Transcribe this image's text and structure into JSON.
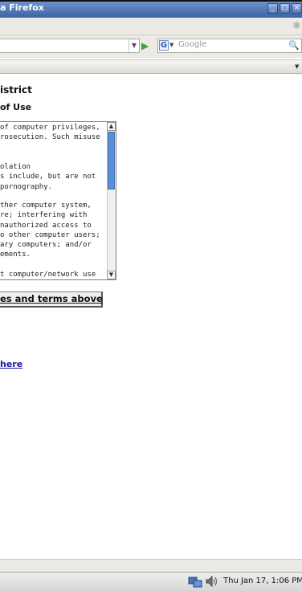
{
  "window": {
    "title": "a Firefox",
    "controls": [
      "_",
      "□",
      "×"
    ]
  },
  "toolbar": {
    "url_value": "",
    "search_placeholder": "Google",
    "search_engine_letter": "G"
  },
  "content": {
    "heading": "istrict",
    "subheading": "of Use",
    "terms_lines": [
      "of computer privileges,",
      "rosecution. Such misuse",
      "",
      "",
      "olation",
      "s include, but are not",
      " pornography.",
      "",
      "ther computer system,",
      "re; interfering with",
      "nauthorized access to",
      "o other computer users;",
      "ary computers; and/or",
      "ements.",
      "",
      "t computer/network use"
    ],
    "agree_button_label": "es and terms above",
    "here_link": "here"
  },
  "taskbar": {
    "clock": "Thu Jan 17,  1:06 PM"
  }
}
